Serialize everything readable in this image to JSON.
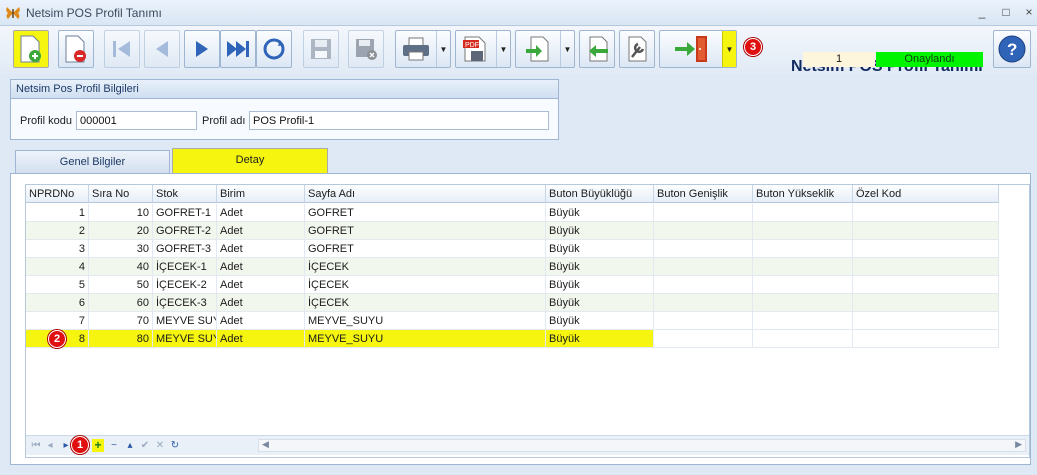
{
  "window": {
    "title": "Netsim POS Profil Tanımı",
    "min": "_",
    "max": "□",
    "close": "×"
  },
  "header": {
    "title": "Netsim POS Profil Tanımı",
    "record_number": "1",
    "status": "Onaylandı",
    "status_color": "#00f400"
  },
  "badges": {
    "b1": "1",
    "b2": "2",
    "b3": "3"
  },
  "group": {
    "title": "Netsim Pos Profil Bilgileri",
    "profile_code_label": "Profil kodu",
    "profile_code_value": "000001",
    "profile_name_label": "Profil adı",
    "profile_name_value": "POS Profil-1"
  },
  "tabs": {
    "general": "Genel Bilgiler",
    "detail": "Detay"
  },
  "grid": {
    "columns": [
      "NPRDNo",
      "Sıra No",
      "Stok",
      "Birim",
      "Sayfa Adı",
      "Buton Büyüklüğü",
      "Buton Genişlik",
      "Buton Yükseklik",
      "Özel Kod"
    ],
    "rows": [
      [
        "1",
        "10",
        "GOFRET-1",
        "Adet",
        "GOFRET",
        "Büyük",
        "",
        "",
        ""
      ],
      [
        "2",
        "20",
        "GOFRET-2",
        "Adet",
        "GOFRET",
        "Büyük",
        "",
        "",
        ""
      ],
      [
        "3",
        "30",
        "GOFRET-3",
        "Adet",
        "GOFRET",
        "Büyük",
        "",
        "",
        ""
      ],
      [
        "4",
        "40",
        "İÇECEK-1",
        "Adet",
        "İÇECEK",
        "Büyük",
        "",
        "",
        ""
      ],
      [
        "5",
        "50",
        "İÇECEK-2",
        "Adet",
        "İÇECEK",
        "Büyük",
        "",
        "",
        ""
      ],
      [
        "6",
        "60",
        "İÇECEK-3",
        "Adet",
        "İÇECEK",
        "Büyük",
        "",
        "",
        ""
      ],
      [
        "7",
        "70",
        "MEYVE SUYU",
        "Adet",
        "MEYVE_SUYU",
        "Büyük",
        "",
        "",
        ""
      ],
      [
        "8",
        "80",
        "MEYVE SUYU",
        "Adet",
        "MEYVE_SUYU",
        "Büyük",
        "",
        "",
        ""
      ]
    ],
    "selected_row_color": "#f5f50f",
    "alt_row_color": "#f2f7ee"
  },
  "navigator": [
    "first-icon",
    "prev-page-icon",
    "prev-icon",
    "next-icon",
    "add-icon",
    "delete-icon",
    "edit-icon",
    "post-icon",
    "cancel-icon",
    "refresh-icon"
  ],
  "toolbar_icons": [
    "new-record-icon",
    "delete-record-icon",
    "first-record-icon",
    "previous-record-icon",
    "next-record-icon",
    "last-record-icon",
    "refresh-icon",
    "save-icon",
    "save-cancel-icon",
    "print-icon",
    "pdf-export-icon",
    "export-icon",
    "import-icon",
    "settings-icon",
    "exit-icon",
    "help-icon"
  ]
}
